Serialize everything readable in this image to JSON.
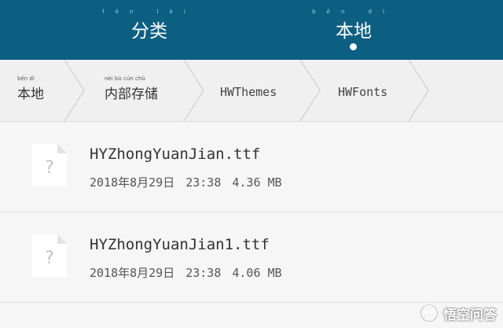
{
  "header": {
    "tabs": [
      {
        "label": "分类",
        "ruby": "fēn lèi",
        "active": false
      },
      {
        "label": "本地",
        "ruby": "běn dì",
        "active": true
      }
    ],
    "background_color": "#0d5f82"
  },
  "breadcrumb": [
    {
      "label": "本地",
      "ruby": "běn dì"
    },
    {
      "label": "内部存储",
      "ruby": "nèi bù cún chǔ"
    },
    {
      "label": "HWThemes"
    },
    {
      "label": "HWFonts"
    }
  ],
  "files": [
    {
      "name": "HYZhongYuanJian.ttf",
      "date": "2018年8月29日",
      "time": "23:38",
      "size": "4.36 MB",
      "icon": "unknown-file-icon"
    },
    {
      "name": "HYZhongYuanJian1.ttf",
      "date": "2018年8月29日",
      "time": "23:38",
      "size": "4.06 MB",
      "icon": "unknown-file-icon"
    }
  ],
  "watermark": {
    "text": "悟空问答"
  }
}
